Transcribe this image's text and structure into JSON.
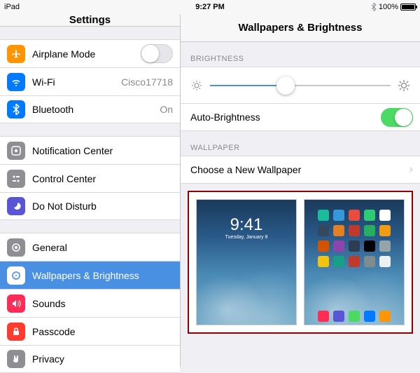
{
  "statusbar": {
    "device": "iPad",
    "time": "9:27 PM",
    "battery": "100%"
  },
  "sidebar": {
    "title": "Settings",
    "groups": [
      {
        "items": [
          {
            "id": "airplane",
            "label": "Airplane Mode",
            "accessory": "toggle-off",
            "icon_bg": "#ff9500"
          },
          {
            "id": "wifi",
            "label": "Wi-Fi",
            "value": "Cisco17718",
            "icon_bg": "#007aff"
          },
          {
            "id": "bluetooth",
            "label": "Bluetooth",
            "value": "On",
            "icon_bg": "#007aff"
          }
        ]
      },
      {
        "items": [
          {
            "id": "notifications",
            "label": "Notification Center",
            "icon_bg": "#8e8e93"
          },
          {
            "id": "controlcenter",
            "label": "Control Center",
            "icon_bg": "#8e8e93"
          },
          {
            "id": "dnd",
            "label": "Do Not Disturb",
            "icon_bg": "#5856d6"
          }
        ]
      },
      {
        "items": [
          {
            "id": "general",
            "label": "General",
            "icon_bg": "#8e8e93"
          },
          {
            "id": "wallpapers",
            "label": "Wallpapers & Brightness",
            "icon_bg": "#4a90e2",
            "selected": true
          },
          {
            "id": "sounds",
            "label": "Sounds",
            "icon_bg": "#ff3b30"
          },
          {
            "id": "passcode",
            "label": "Passcode",
            "icon_bg": "#ff3b30"
          },
          {
            "id": "privacy",
            "label": "Privacy",
            "icon_bg": "#8e8e93"
          }
        ]
      }
    ]
  },
  "detail": {
    "title": "Wallpapers & Brightness",
    "brightness_section": "BRIGHTNESS",
    "auto_brightness": "Auto-Brightness",
    "wallpaper_section": "WALLPAPER",
    "choose_wallpaper": "Choose a New Wallpaper",
    "lock_preview": {
      "time": "9:41",
      "date": "Tuesday, January 8"
    },
    "home_preview": {
      "app_colors": [
        "#1abc9c",
        "#3498db",
        "#e74c3c",
        "#2ecc71",
        "#fff",
        "#34495e",
        "#e67e22",
        "#c0392b",
        "#27ae60",
        "#f39c12",
        "#d35400",
        "#8e44ad",
        "#2c3e50",
        "#000",
        "#95a5a6",
        "#f1c40f",
        "#16a085",
        "#c0392b",
        "#7f8c8d",
        "#ecf0f1"
      ],
      "dock_colors": [
        "#ff2d55",
        "#5856d6",
        "#4cd964",
        "#007aff",
        "#ff9500"
      ]
    }
  }
}
